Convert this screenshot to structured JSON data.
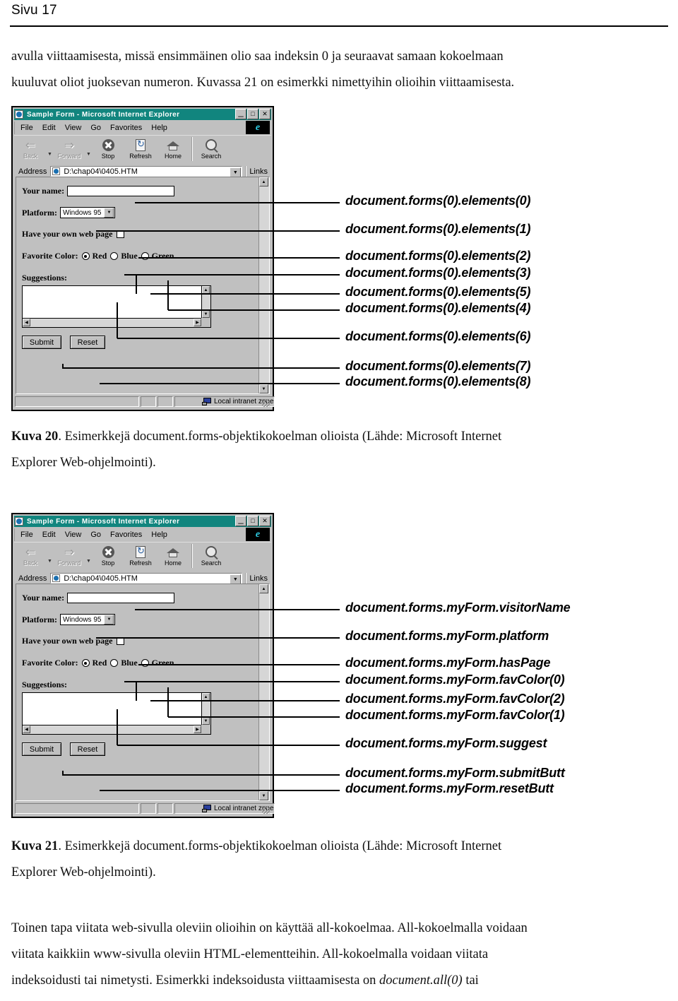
{
  "page": {
    "header": "Sivu 17"
  },
  "paragraphs": {
    "intro": [
      "avulla viittaamisesta, missä ensimmäinen olio saa indeksin 0 ja seuraavat samaan kokoelmaan",
      "kuuluvat oliot juoksevan numeron.  Kuvassa 21 on esimerkki nimettyihin olioihin viittaamisesta."
    ],
    "outro": [
      "Toinen tapa viitata web-sivulla oleviin olioihin on käyttää all-kokoelmaa. All-kokoelmalla voidaan",
      "viitata kaikkiin www-sivulla oleviin HTML-elementteihin. All-kokoelmalla voidaan viitata",
      "indeksoidusti tai nimetysti. Esimerkki indeksoidusta viittaamisesta on "
    ],
    "outro_italic": "document.all(0)",
    "outro_tail": " tai"
  },
  "captions": {
    "fig20": {
      "number": "Kuva 20",
      "line1": ". Esimerkkejä document.forms-objektikokoelman olioista (Lähde: Microsoft Internet",
      "line2": "Explorer Web-ohjelmointi)."
    },
    "fig21": {
      "number": "Kuva 21",
      "line1": ". Esimerkkejä document.forms-objektikokoelman olioista (Lähde: Microsoft Internet",
      "line2": "Explorer Web-ohjelmointi)."
    }
  },
  "browser": {
    "title": "Sample Form - Microsoft Internet Explorer",
    "window_buttons": {
      "minimize": "_",
      "maximize": "□",
      "close": "✕"
    },
    "menu": [
      "File",
      "Edit",
      "View",
      "Go",
      "Favorites",
      "Help"
    ],
    "logo": "e",
    "toolbar": [
      {
        "name": "back",
        "label": "Back",
        "icon": "left-arrow-icon",
        "disabled": true
      },
      {
        "name": "forward",
        "label": "Forward",
        "icon": "right-arrow-icon",
        "disabled": true
      },
      {
        "name": "stop",
        "label": "Stop",
        "icon": "stop-icon",
        "disabled": false
      },
      {
        "name": "refresh",
        "label": "Refresh",
        "icon": "refresh-icon",
        "disabled": false
      },
      {
        "name": "home",
        "label": "Home",
        "icon": "home-icon",
        "disabled": false
      },
      {
        "name": "search",
        "label": "Search",
        "icon": "search-icon",
        "disabled": false
      }
    ],
    "address": {
      "label": "Address",
      "value": "D:\\chap04\\0405.HTM"
    },
    "links_label": "Links",
    "statusbar": {
      "zone": "Local intranet zone"
    }
  },
  "form": {
    "name_label": "Your name:",
    "name_value": "",
    "platform_label": "Platform:",
    "platform_value": "Windows 95",
    "platform_options": [
      "Windows 95"
    ],
    "haspage_label": "Have your own web page",
    "haspage_checked": false,
    "color_label": "Favorite Color:",
    "colors": [
      {
        "label": "Red",
        "selected": true
      },
      {
        "label": "Blue",
        "selected": false
      },
      {
        "label": "Green",
        "selected": false
      }
    ],
    "suggestions_label": "Suggestions:",
    "suggestions_value": "",
    "submit_label": "Submit",
    "reset_label": "Reset"
  },
  "figure20": {
    "callouts": [
      "document.forms(0).elements(0)",
      "document.forms(0).elements(1)",
      "document.forms(0).elements(2)",
      "document.forms(0).elements(3)",
      "document.forms(0).elements(5)",
      "document.forms(0).elements(4)",
      "document.forms(0).elements(6)",
      "document.forms(0).elements(7)",
      "document.forms(0).elements(8)"
    ]
  },
  "figure21": {
    "callouts": [
      "document.forms.myForm.visitorName",
      "document.forms.myForm.platform",
      "document.forms.myForm.hasPage",
      "document.forms.myForm.favColor(0)",
      "document.forms.myForm.favColor(2)",
      "document.forms.myForm.favColor(1)",
      "document.forms.myForm.suggest",
      "document.forms.myForm.submitButt",
      "document.forms.myForm.resetButt"
    ]
  }
}
